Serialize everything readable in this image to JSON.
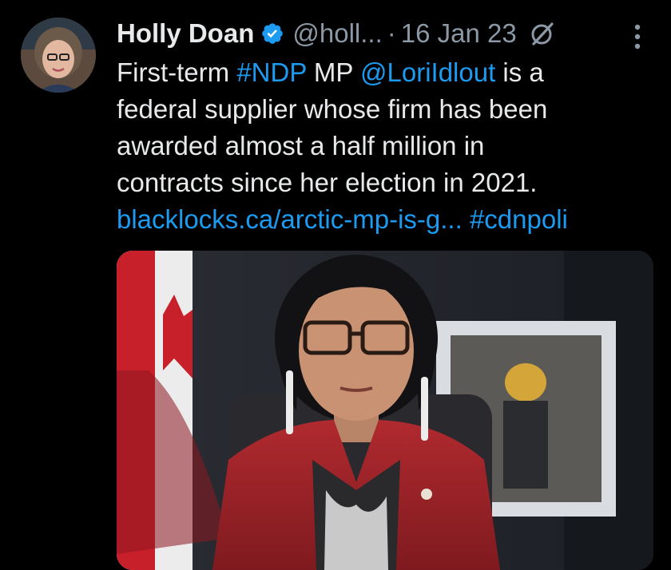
{
  "tweet": {
    "author": {
      "display_name": "Holly Doan",
      "verified": true,
      "verified_icon": "verified-badge-icon",
      "handle": "@holl...",
      "avatar": "author-avatar"
    },
    "separator": "·",
    "date": "16 Jan 23",
    "icons": {
      "grok": "grok-icon",
      "more": "more-options-icon"
    },
    "text": {
      "line1": {
        "pre": "First-term ",
        "hashtag": "#NDP",
        "mid": " MP ",
        "mention": "@LoriIdlout",
        "post": " is a"
      },
      "line2": "federal supplier whose firm has been",
      "line3": "awarded almost a half million in",
      "line4": "contracts since her election in 2021.",
      "line5": {
        "link": "blacklocks.ca/arctic-mp-is-g...",
        "space": " ",
        "hashtag": "#cdnpoli"
      }
    },
    "media": {
      "description_icon": "photo-of-woman-speaking"
    },
    "colors": {
      "background": "#000000",
      "text": "#e7e9ea",
      "muted": "#8b98a5",
      "link": "#1d9bf0",
      "verified": "#1d9bf0"
    }
  }
}
